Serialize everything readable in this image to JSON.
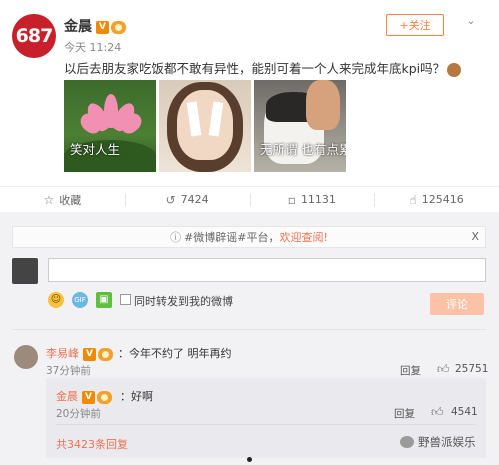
{
  "post": {
    "avatar_text": "687",
    "author": "金晨",
    "verified_badge": "V",
    "time": "今天 11:24",
    "follow_label": "+关注",
    "menu_icon": "chevron-down-icon",
    "text": "以后去朋友家吃饭都不敢有异性，能别可着一个人来完成年底kpi吗？",
    "photos": [
      {
        "caption": "笑对人生"
      },
      {
        "caption": ""
      },
      {
        "caption": "无所谓 也有点累"
      }
    ]
  },
  "actions": [
    {
      "icon": "star-icon",
      "label": "收藏"
    },
    {
      "icon": "repost-icon",
      "label": "7424"
    },
    {
      "icon": "comment-icon",
      "label": "11131"
    },
    {
      "icon": "like-icon",
      "label": "125416"
    }
  ],
  "comment_panel": {
    "notice_prefix": "#微博辟谣#平台，",
    "notice_link": "欢迎查阅!",
    "notice_close": "X",
    "input_placeholder": "",
    "repost_label": "同时转发到我的微博",
    "submit_label": "评论"
  },
  "comments": [
    {
      "name": "李易峰",
      "text": "：今年不约了 明年再约",
      "time": "37分钟前",
      "reply_label": "回复",
      "likes": "25751",
      "replies": [
        {
          "name": "金晨",
          "text": "：好啊",
          "time": "20分钟前",
          "reply_label": "回复",
          "likes": "4541"
        }
      ],
      "total_replies": "共3423条回复"
    }
  ],
  "watermark": "野兽派娱乐",
  "colors": {
    "accent": "#eb7350",
    "follow": "#ff8140",
    "submit_disabled": "#fbc2a5"
  }
}
